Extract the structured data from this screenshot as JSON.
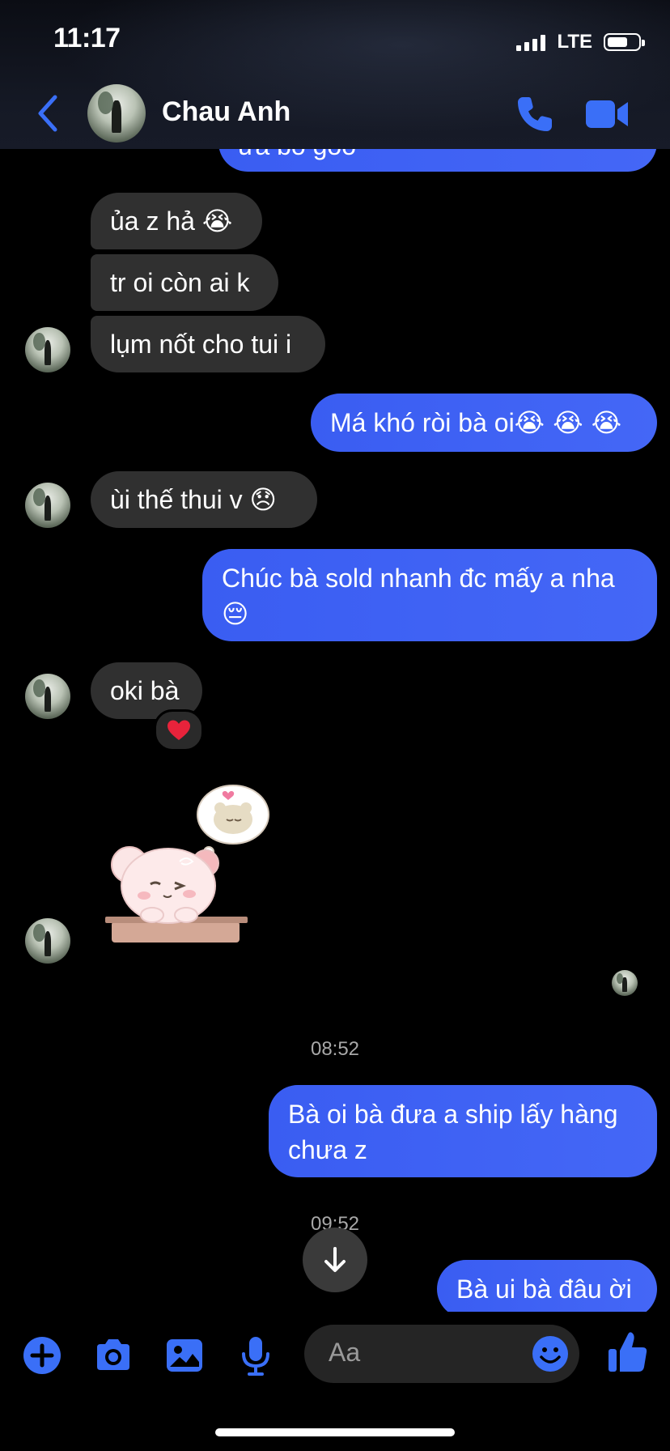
{
  "status_bar": {
    "time": "11:17",
    "network": "LTE",
    "battery_level": 0.6
  },
  "header": {
    "contact_name": "Chau Anh",
    "icons": {
      "back": "chevron-left-icon",
      "call": "phone-icon",
      "video": "video-camera-icon"
    },
    "accent_color": "#3a6ff7"
  },
  "messages": [
    {
      "side": "out",
      "text": "ưa bo goo",
      "partial": true
    },
    {
      "side": "in",
      "text": "ủa z hả",
      "emoji": "😭"
    },
    {
      "side": "in",
      "text": "tr oi còn ai k"
    },
    {
      "side": "in",
      "text": "lụm nốt cho tui i"
    },
    {
      "side": "out",
      "text": "Má khó ròi bà oi",
      "emoji": "😭 😭 😭"
    },
    {
      "side": "in",
      "text": "ùi thế thui v",
      "emoji": "😞"
    },
    {
      "side": "out",
      "text": "Chúc bà sold nhanh đc mấy a nha",
      "emoji": "😔"
    },
    {
      "side": "in",
      "text": "oki bà",
      "reaction": "❤️"
    },
    {
      "side": "in",
      "sticker": "bear-sticker"
    },
    {
      "side": "out",
      "text": "Bà oi bà đưa a ship lấy hàng",
      "text2": "chưa z"
    },
    {
      "side": "out",
      "text": "Bà ui bà đâu ời"
    }
  ],
  "timestamps": [
    "08:52",
    "09:52"
  ],
  "composer": {
    "placeholder": "Aa",
    "icons": [
      "plus-icon",
      "camera-icon",
      "image-icon",
      "microphone-icon",
      "emoji-icon",
      "thumbs-up-icon"
    ]
  },
  "colors": {
    "incoming_bubble": "#303030",
    "outgoing_bubble": "#3f63f5",
    "background": "#000000"
  }
}
